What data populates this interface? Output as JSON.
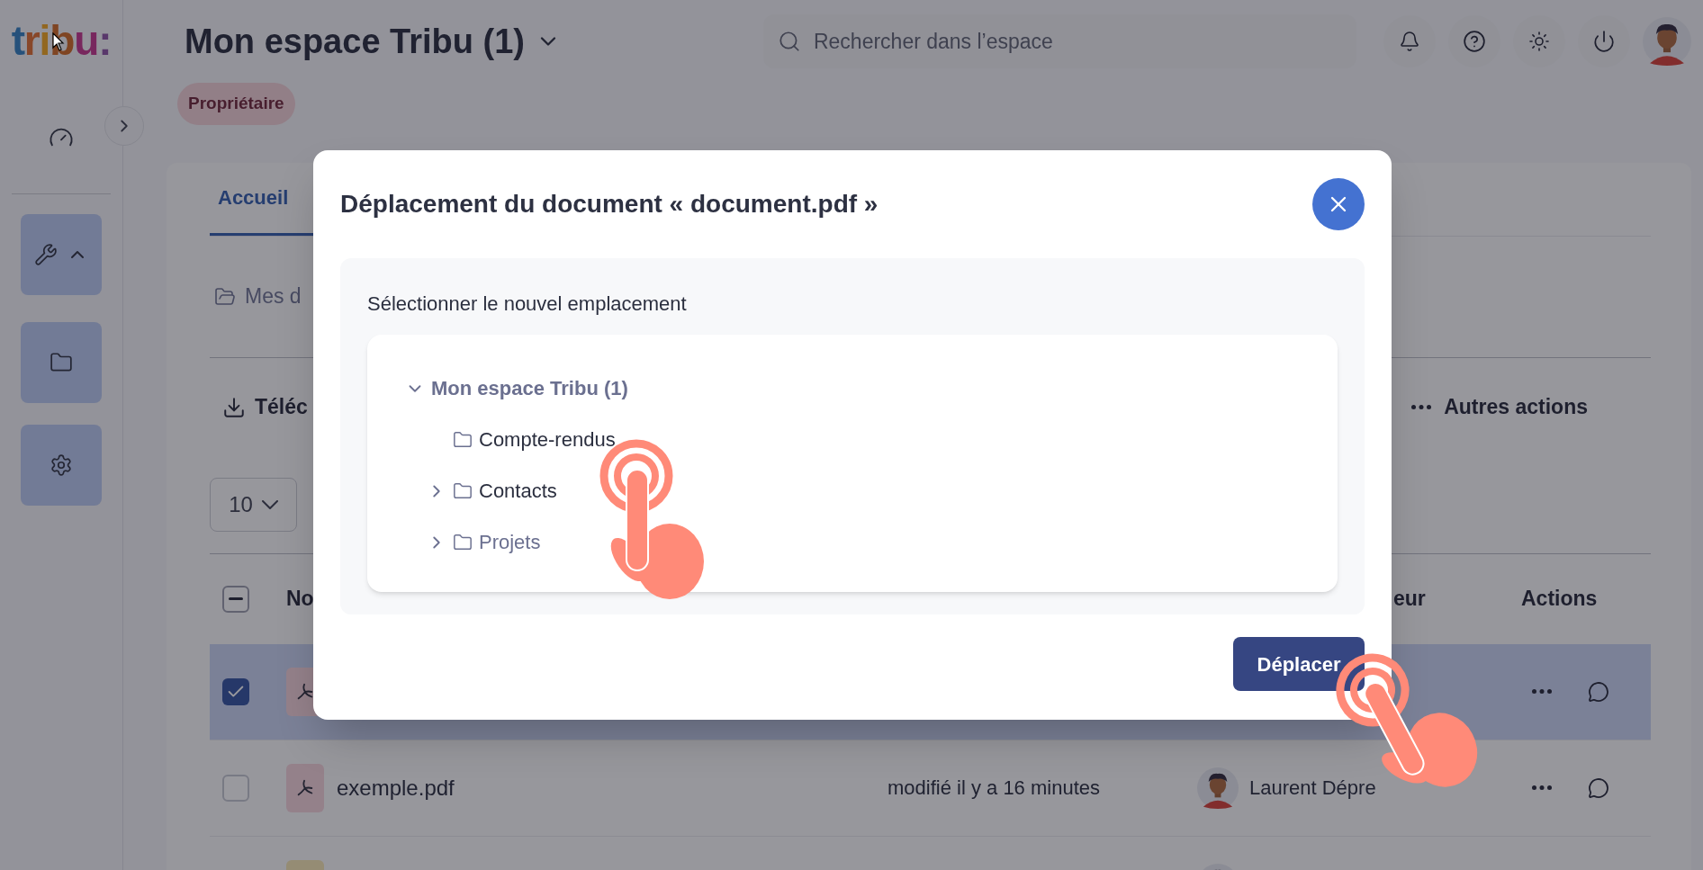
{
  "logo": "tribu:",
  "sidebar": {
    "tools_menu": {
      "expanded": true
    }
  },
  "header": {
    "title": "Mon espace Tribu (1)",
    "role_badge": "Propriétaire",
    "search": {
      "placeholder": "Rechercher dans l’espace"
    }
  },
  "tabs": [
    {
      "label": "Accueil",
      "selected": true
    }
  ],
  "breadcrumb": "Mes d",
  "toolbar": {
    "download": "Téléc",
    "more": "Autres actions"
  },
  "page_size": "10",
  "table": {
    "header_indeterminate": true,
    "columns": [
      "No",
      "eur",
      "Actions"
    ],
    "rows": [
      {
        "selected": true,
        "kind": "pdf",
        "show_avatar": false
      },
      {
        "selected": false,
        "kind": "pdf",
        "name": "exemple.pdf",
        "modified": "modifié il y a 16 minutes",
        "author": "Laurent Dépre",
        "show_avatar": true
      },
      {
        "kind": "image",
        "show_avatar": true
      }
    ]
  },
  "dialog": {
    "title": "Déplacement du document « document.pdf »",
    "prompt": "Sélectionner le nouvel emplacement",
    "tree": [
      {
        "label": "Mon espace Tribu (1)",
        "expanded": true,
        "disabled": true,
        "children": [
          {
            "label": "Compte-rendus",
            "disabled": false
          },
          {
            "label": "Contacts",
            "expanded": false,
            "disabled": false
          },
          {
            "label": "Projets",
            "expanded": false,
            "disabled": true
          }
        ]
      }
    ],
    "confirm": "Déplacer"
  }
}
